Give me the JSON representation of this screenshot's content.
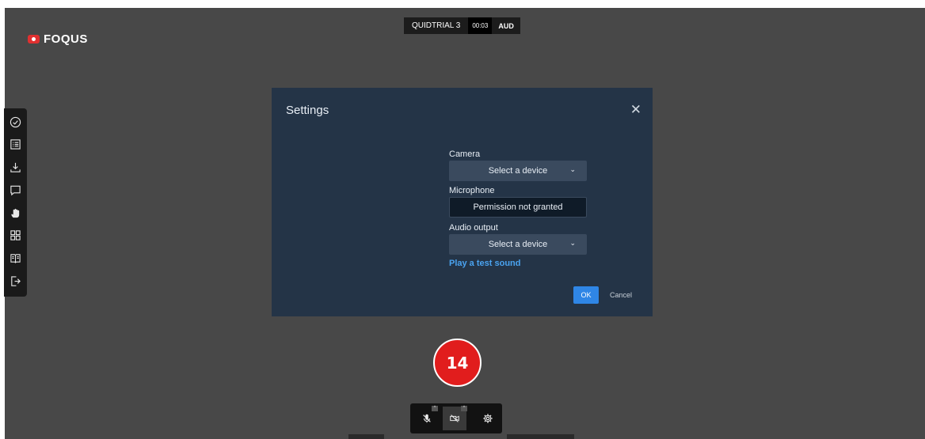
{
  "logo": {
    "text": "FOQUS"
  },
  "topbar": {
    "room": "QUIDTRIAL 3",
    "timer": "00:03",
    "mode": "AUD"
  },
  "sidebar": {
    "items": [
      {
        "icon": "check-circle-icon"
      },
      {
        "icon": "list-icon"
      },
      {
        "icon": "download-icon"
      },
      {
        "icon": "chat-icon"
      },
      {
        "icon": "raise-hand-icon"
      },
      {
        "icon": "grid-icon"
      },
      {
        "icon": "book-icon"
      },
      {
        "icon": "exit-icon"
      }
    ]
  },
  "dialog": {
    "title": "Settings",
    "close": "✕",
    "camera_label": "Camera",
    "camera_value": "Select a device",
    "microphone_label": "Microphone",
    "microphone_value": "Permission not granted",
    "audio_label": "Audio output",
    "audio_value": "Select a device",
    "test_sound": "Play a test sound",
    "ok": "OK",
    "cancel": "Cancel"
  },
  "badge": {
    "number": "14"
  },
  "toolbar": {
    "mic": "mic-off-icon",
    "camera": "camera-off-icon",
    "settings": "gear-icon"
  }
}
